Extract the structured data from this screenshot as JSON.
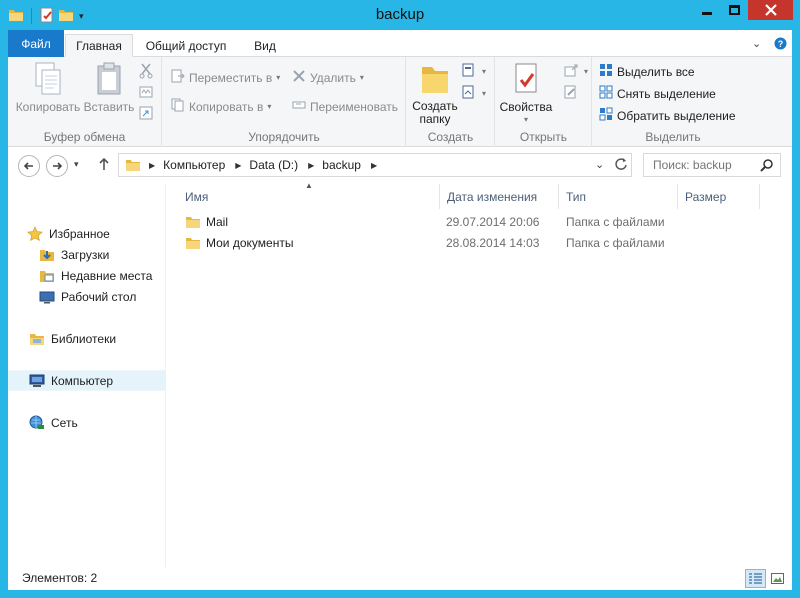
{
  "window": {
    "title": "backup"
  },
  "ribbon": {
    "tabs": {
      "file": "Файл",
      "home": "Главная",
      "share": "Общий доступ",
      "view": "Вид"
    },
    "clipboard": {
      "label": "Буфер обмена",
      "copy": "Копировать",
      "paste": "Вставить"
    },
    "organize": {
      "label": "Упорядочить",
      "move_to": "Переместить в",
      "copy_to": "Копировать в",
      "delete": "Удалить",
      "rename": "Переименовать"
    },
    "create": {
      "label": "Создать",
      "new_folder_1": "Создать",
      "new_folder_2": "папку"
    },
    "open": {
      "label": "Открыть",
      "properties": "Свойства"
    },
    "select": {
      "label": "Выделить",
      "select_all": "Выделить все",
      "select_none": "Снять выделение",
      "invert": "Обратить выделение"
    }
  },
  "address": {
    "crumbs": [
      "Компьютер",
      "Data (D:)",
      "backup"
    ]
  },
  "search": {
    "placeholder": "Поиск: backup"
  },
  "nav": {
    "favorites": "Избранное",
    "downloads": "Загрузки",
    "recent": "Недавние места",
    "desktop": "Рабочий стол",
    "libraries": "Библиотеки",
    "computer": "Компьютер",
    "network": "Сеть"
  },
  "columns": {
    "name": "Имя",
    "date": "Дата изменения",
    "type": "Тип",
    "size": "Размер"
  },
  "files": [
    {
      "name": "Mail",
      "date": "29.07.2014 20:06",
      "type": "Папка с файлами"
    },
    {
      "name": "Мои документы",
      "date": "28.08.2014 14:03",
      "type": "Папка с файлами"
    }
  ],
  "status": {
    "count": "Элементов: 2"
  },
  "colors": {
    "titlebar": "#28b6e6",
    "file_tab": "#1979ca",
    "close": "#c6352b",
    "folder": "#e8b740"
  }
}
